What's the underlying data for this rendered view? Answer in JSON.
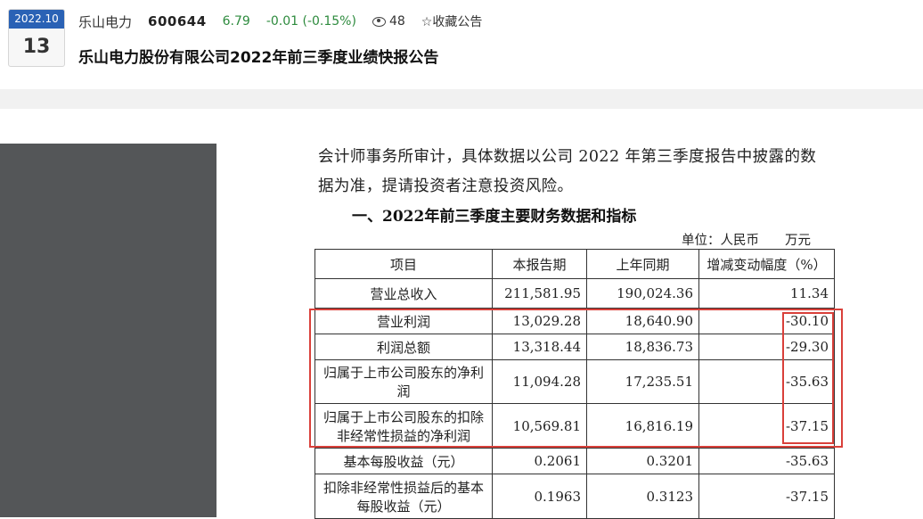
{
  "header": {
    "date_month": "2022.10",
    "date_day": "13",
    "stock_name": "乐山电力",
    "stock_code": "600644",
    "price": "6.79",
    "change": "-0.01 (-0.15%)",
    "views": "48",
    "favorite_label": "☆收藏公告",
    "title": "乐山电力股份有限公司2022年前三季度业绩快报公告"
  },
  "document": {
    "para_line1": "会计师事务所审计，具体数据以公司 2022 年第三季度报告中披露的数",
    "para_line2": "据为准，提请投资者注意投资风险。",
    "section_title": "一、2022年前三季度主要财务数据和指标",
    "unit": "单位：人民币　　万元",
    "table": {
      "headers": [
        "项目",
        "本报告期",
        "上年同期",
        "增减变动幅度（%）"
      ],
      "rows": [
        [
          "营业总收入",
          "211,581.95",
          "190,024.36",
          "11.34"
        ],
        [
          "营业利润",
          "13,029.28",
          "18,640.90",
          "-30.10"
        ],
        [
          "利润总额",
          "13,318.44",
          "18,836.73",
          "-29.30"
        ],
        [
          "归属于上市公司股东的净利润",
          "11,094.28",
          "17,235.51",
          "-35.63"
        ],
        [
          "归属于上市公司股东的扣除非经常性损益的净利润",
          "10,569.81",
          "16,816.19",
          "-37.15"
        ],
        [
          "基本每股收益（元）",
          "0.2061",
          "0.3201",
          "-35.63"
        ],
        [
          "扣除非经常性损益后的基本每股收益（元）",
          "0.1963",
          "0.3123",
          "-37.15"
        ]
      ]
    }
  },
  "colors": {
    "accent_blue": "#2a62b5",
    "stock_green": "#2e8b3e",
    "highlight_red": "#d9403a"
  }
}
